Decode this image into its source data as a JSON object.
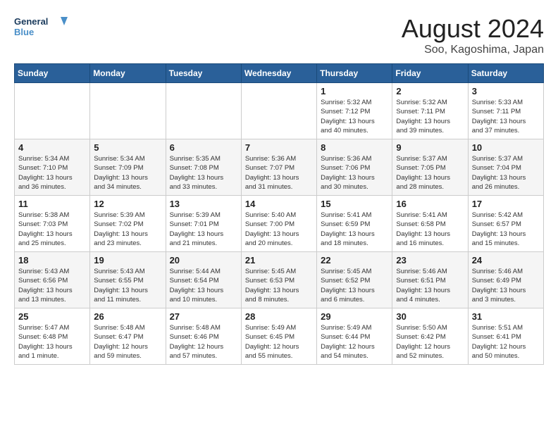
{
  "header": {
    "logo_line1": "General",
    "logo_line2": "Blue",
    "month_year": "August 2024",
    "location": "Soo, Kagoshima, Japan"
  },
  "weekdays": [
    "Sunday",
    "Monday",
    "Tuesday",
    "Wednesday",
    "Thursday",
    "Friday",
    "Saturday"
  ],
  "weeks": [
    [
      {
        "day": "",
        "info": ""
      },
      {
        "day": "",
        "info": ""
      },
      {
        "day": "",
        "info": ""
      },
      {
        "day": "",
        "info": ""
      },
      {
        "day": "1",
        "info": "Sunrise: 5:32 AM\nSunset: 7:12 PM\nDaylight: 13 hours\nand 40 minutes."
      },
      {
        "day": "2",
        "info": "Sunrise: 5:32 AM\nSunset: 7:11 PM\nDaylight: 13 hours\nand 39 minutes."
      },
      {
        "day": "3",
        "info": "Sunrise: 5:33 AM\nSunset: 7:11 PM\nDaylight: 13 hours\nand 37 minutes."
      }
    ],
    [
      {
        "day": "4",
        "info": "Sunrise: 5:34 AM\nSunset: 7:10 PM\nDaylight: 13 hours\nand 36 minutes."
      },
      {
        "day": "5",
        "info": "Sunrise: 5:34 AM\nSunset: 7:09 PM\nDaylight: 13 hours\nand 34 minutes."
      },
      {
        "day": "6",
        "info": "Sunrise: 5:35 AM\nSunset: 7:08 PM\nDaylight: 13 hours\nand 33 minutes."
      },
      {
        "day": "7",
        "info": "Sunrise: 5:36 AM\nSunset: 7:07 PM\nDaylight: 13 hours\nand 31 minutes."
      },
      {
        "day": "8",
        "info": "Sunrise: 5:36 AM\nSunset: 7:06 PM\nDaylight: 13 hours\nand 30 minutes."
      },
      {
        "day": "9",
        "info": "Sunrise: 5:37 AM\nSunset: 7:05 PM\nDaylight: 13 hours\nand 28 minutes."
      },
      {
        "day": "10",
        "info": "Sunrise: 5:37 AM\nSunset: 7:04 PM\nDaylight: 13 hours\nand 26 minutes."
      }
    ],
    [
      {
        "day": "11",
        "info": "Sunrise: 5:38 AM\nSunset: 7:03 PM\nDaylight: 13 hours\nand 25 minutes."
      },
      {
        "day": "12",
        "info": "Sunrise: 5:39 AM\nSunset: 7:02 PM\nDaylight: 13 hours\nand 23 minutes."
      },
      {
        "day": "13",
        "info": "Sunrise: 5:39 AM\nSunset: 7:01 PM\nDaylight: 13 hours\nand 21 minutes."
      },
      {
        "day": "14",
        "info": "Sunrise: 5:40 AM\nSunset: 7:00 PM\nDaylight: 13 hours\nand 20 minutes."
      },
      {
        "day": "15",
        "info": "Sunrise: 5:41 AM\nSunset: 6:59 PM\nDaylight: 13 hours\nand 18 minutes."
      },
      {
        "day": "16",
        "info": "Sunrise: 5:41 AM\nSunset: 6:58 PM\nDaylight: 13 hours\nand 16 minutes."
      },
      {
        "day": "17",
        "info": "Sunrise: 5:42 AM\nSunset: 6:57 PM\nDaylight: 13 hours\nand 15 minutes."
      }
    ],
    [
      {
        "day": "18",
        "info": "Sunrise: 5:43 AM\nSunset: 6:56 PM\nDaylight: 13 hours\nand 13 minutes."
      },
      {
        "day": "19",
        "info": "Sunrise: 5:43 AM\nSunset: 6:55 PM\nDaylight: 13 hours\nand 11 minutes."
      },
      {
        "day": "20",
        "info": "Sunrise: 5:44 AM\nSunset: 6:54 PM\nDaylight: 13 hours\nand 10 minutes."
      },
      {
        "day": "21",
        "info": "Sunrise: 5:45 AM\nSunset: 6:53 PM\nDaylight: 13 hours\nand 8 minutes."
      },
      {
        "day": "22",
        "info": "Sunrise: 5:45 AM\nSunset: 6:52 PM\nDaylight: 13 hours\nand 6 minutes."
      },
      {
        "day": "23",
        "info": "Sunrise: 5:46 AM\nSunset: 6:51 PM\nDaylight: 13 hours\nand 4 minutes."
      },
      {
        "day": "24",
        "info": "Sunrise: 5:46 AM\nSunset: 6:49 PM\nDaylight: 13 hours\nand 3 minutes."
      }
    ],
    [
      {
        "day": "25",
        "info": "Sunrise: 5:47 AM\nSunset: 6:48 PM\nDaylight: 13 hours\nand 1 minute."
      },
      {
        "day": "26",
        "info": "Sunrise: 5:48 AM\nSunset: 6:47 PM\nDaylight: 12 hours\nand 59 minutes."
      },
      {
        "day": "27",
        "info": "Sunrise: 5:48 AM\nSunset: 6:46 PM\nDaylight: 12 hours\nand 57 minutes."
      },
      {
        "day": "28",
        "info": "Sunrise: 5:49 AM\nSunset: 6:45 PM\nDaylight: 12 hours\nand 55 minutes."
      },
      {
        "day": "29",
        "info": "Sunrise: 5:49 AM\nSunset: 6:44 PM\nDaylight: 12 hours\nand 54 minutes."
      },
      {
        "day": "30",
        "info": "Sunrise: 5:50 AM\nSunset: 6:42 PM\nDaylight: 12 hours\nand 52 minutes."
      },
      {
        "day": "31",
        "info": "Sunrise: 5:51 AM\nSunset: 6:41 PM\nDaylight: 12 hours\nand 50 minutes."
      }
    ]
  ]
}
